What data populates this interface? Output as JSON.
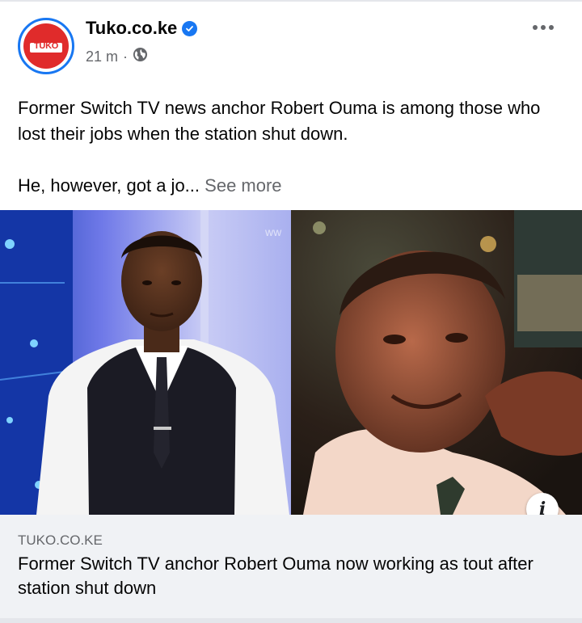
{
  "post": {
    "page_name": "Tuko.co.ke",
    "avatar_text": "TUKO",
    "timestamp": "21 m",
    "separator": "·",
    "text_line1": "Former Switch TV news anchor Robert Ouma is among those who lost their jobs when the station shut down.",
    "text_line2": "He, however, got a jo...",
    "see_more": "See more",
    "image_watermark": "ww"
  },
  "link": {
    "domain": "TUKO.CO.KE",
    "title": "Former Switch TV anchor Robert Ouma now working as tout after station shut down",
    "info_icon": "i"
  },
  "icons": {
    "verified": "verified-badge-icon",
    "audience": "globe-icon",
    "more": "more-options-icon",
    "info": "info-icon"
  },
  "colors": {
    "brand_red": "#e02b2b",
    "facebook_blue": "#1877f2",
    "secondary_text": "#65676b",
    "card_background": "#f0f2f5"
  }
}
